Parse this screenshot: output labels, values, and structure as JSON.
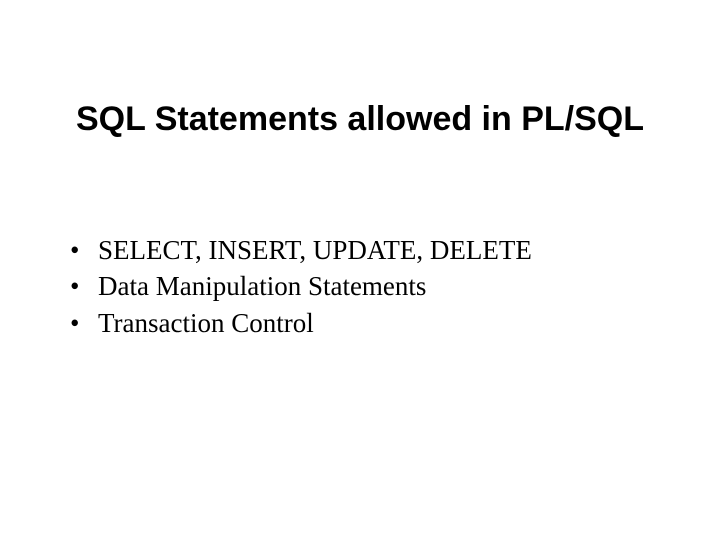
{
  "title": "SQL Statements allowed in PL/SQL",
  "bullets": [
    "SELECT, INSERT, UPDATE, DELETE",
    "Data Manipulation Statements",
    "Transaction Control"
  ]
}
